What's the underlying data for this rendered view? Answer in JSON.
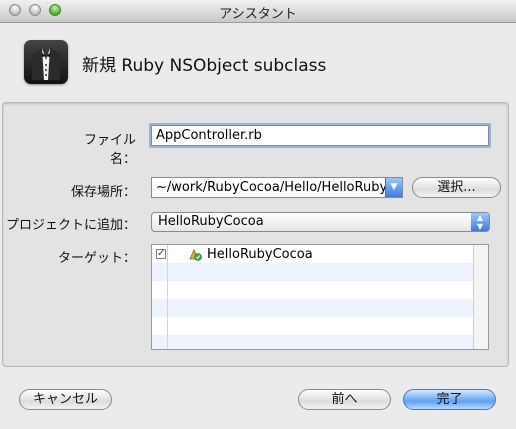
{
  "window": {
    "title": "アシスタント"
  },
  "header": {
    "title": "新規 Ruby NSObject subclass",
    "icon": "tuxedo-icon"
  },
  "form": {
    "file_name_label": "ファイル名：",
    "file_name_value": "AppController.rb",
    "location_label": "保存場所：",
    "location_value": "~/work/RubyCocoa/Hello/HelloRuby",
    "choose_button": "選択...",
    "project_label": "プロジェクトに追加：",
    "project_value": "HelloRubyCocoa",
    "targets_label": "ターゲット：",
    "targets": [
      {
        "name": "HelloRubyCocoa",
        "checked": true,
        "icon": "target-app-icon"
      }
    ]
  },
  "footer": {
    "cancel": "キャンセル",
    "previous": "前へ",
    "finish": "完了"
  },
  "colors": {
    "accent": "#5ea1f1",
    "list_alt_row": "#edf3fe",
    "focus_ring": "#94b5e2"
  }
}
